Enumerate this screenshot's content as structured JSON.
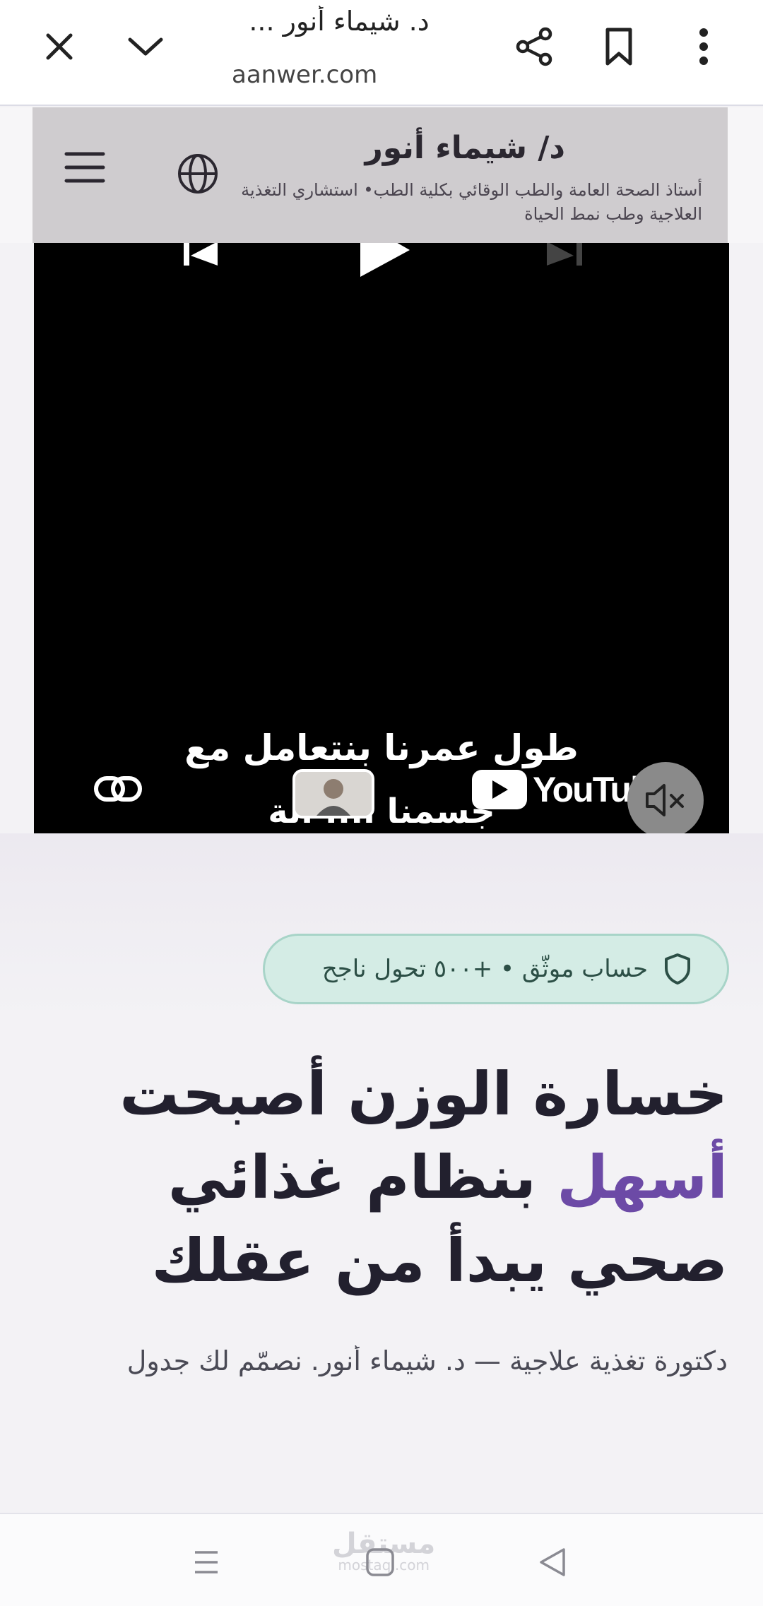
{
  "browser": {
    "title": "د. شيماء أنور ...",
    "url_prefix": "a",
    "url": "aanwer.com"
  },
  "site": {
    "name": "د/ شيماء أنور",
    "tagline": "أستاذ الصحة العامة والطب الوقائي بكلية الطب• استشاري التغذية العلاجية وطب نمط الحياة"
  },
  "video": {
    "caption_line1": "طول عمرنا بنتعامل مع",
    "caption_line2": "جسمنا أ... الة",
    "youtube_label": "YouTube"
  },
  "badge": {
    "text": "حساب موثّق • +٥٠٠ تحول ناجح"
  },
  "hero": {
    "headline_part1": "خسارة الوزن أصبحت ",
    "headline_accent": "أسهل",
    "headline_part2": " بنظام غذائي صحي يبدأ من عقلك",
    "subtext": "دكتورة تغذية علاجية — د. شيماء أنور. نصمّم لك جدول"
  },
  "watermark": {
    "main": "مستقل",
    "sub": "mostaql.com"
  },
  "colors": {
    "accent": "#6c4aa6",
    "badge_bg": "#d4ece5",
    "badge_text": "#2c4f46"
  }
}
